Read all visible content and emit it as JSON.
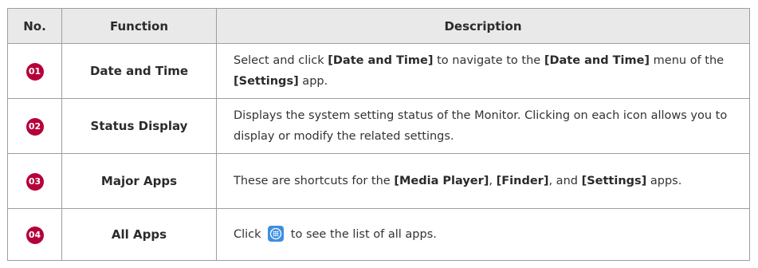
{
  "table": {
    "headers": {
      "no": "No.",
      "function": "Function",
      "description": "Description"
    },
    "rows": [
      {
        "no": "01",
        "function": "Date and Time",
        "description": {
          "t1": "Select and click ",
          "b1": "[Date and Time]",
          "t2": " to navigate to the ",
          "b2": "[Date and Time]",
          "t3": " menu of the ",
          "b3": "[Settings]",
          "t4": " app."
        }
      },
      {
        "no": "02",
        "function": "Status Display",
        "description": {
          "t1": "Displays the system setting status of the Monitor. Clicking on each icon allows you to display or modify the related settings."
        }
      },
      {
        "no": "03",
        "function": "Major Apps",
        "description": {
          "t1": "These are shortcuts for the ",
          "b1": "[Media Player]",
          "t2": ", ",
          "b2": "[Finder]",
          "t3": ", and ",
          "b3": "[Settings]",
          "t4": " apps."
        }
      },
      {
        "no": "04",
        "function": "All Apps",
        "description": {
          "t1": "Click ",
          "icon": "all-apps-icon",
          "t2": " to see the list of all apps."
        }
      }
    ]
  },
  "colors": {
    "badge": "#b5003a",
    "header_bg": "#e9e9e9",
    "border": "#9e9e9e",
    "apps_icon": "#3d8fe0"
  }
}
